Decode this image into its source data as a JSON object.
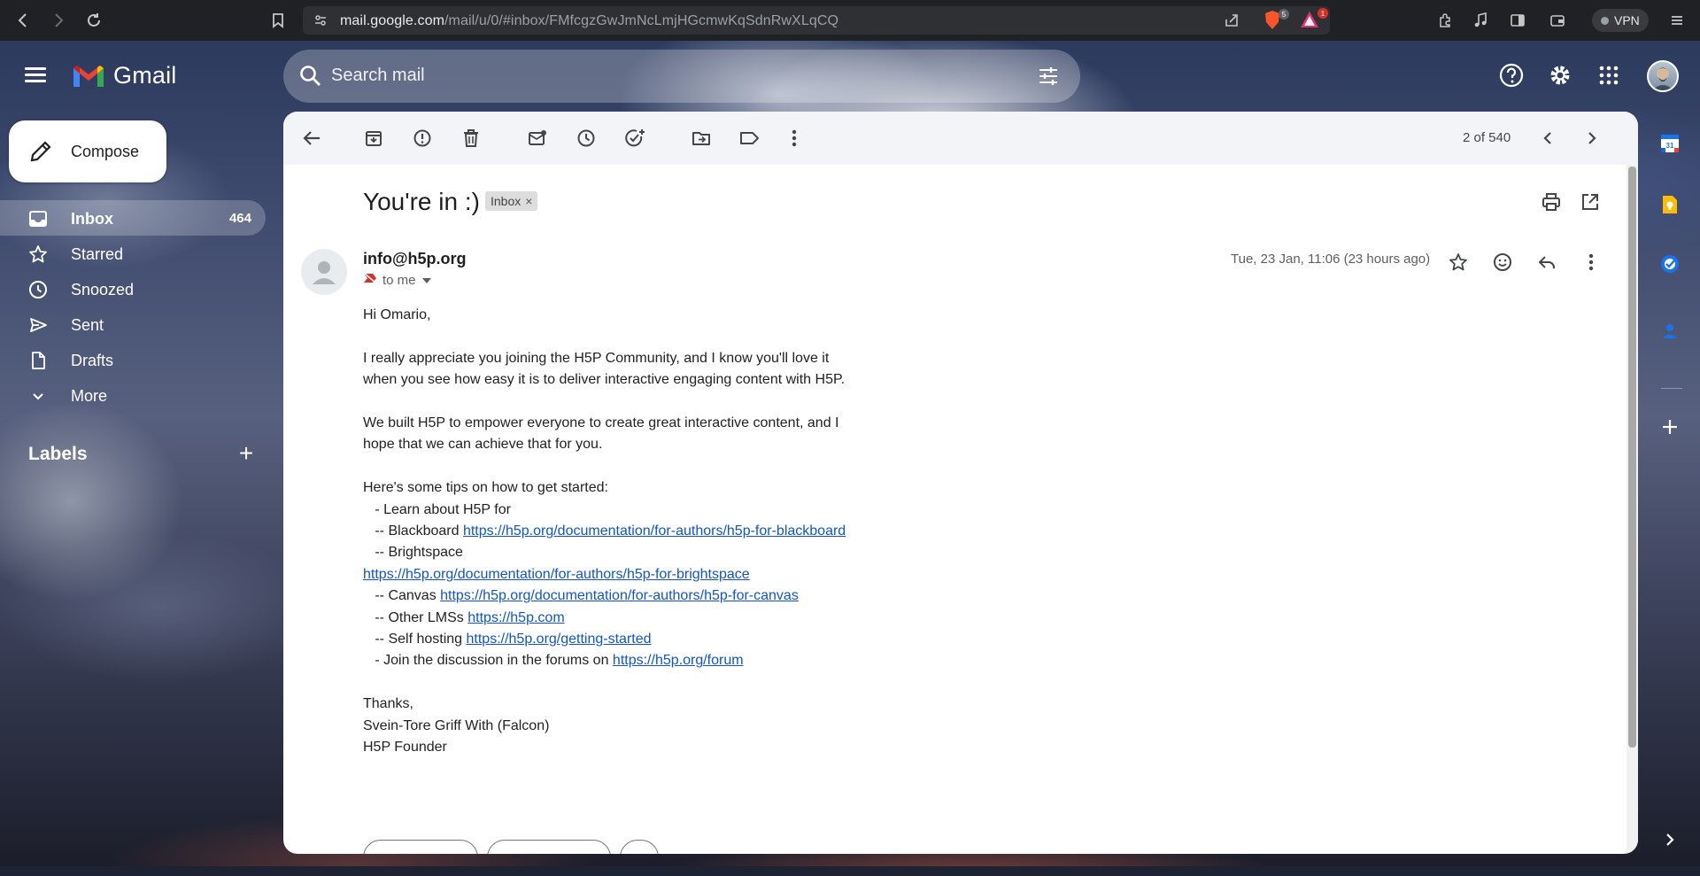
{
  "browser": {
    "url_host": "mail.google.com",
    "url_path": "/mail/u/0/#inbox/FMfcgzGwJmNcLmjHGcmwKqSdnRwXLqCQ",
    "brave_badge": "5",
    "rewards_badge": "1",
    "vpn_label": "VPN"
  },
  "header": {
    "app_name": "Gmail",
    "search_placeholder": "Search mail"
  },
  "sidebar": {
    "compose_label": "Compose",
    "items": [
      {
        "label": "Inbox",
        "count": "464",
        "icon": "inbox-icon"
      },
      {
        "label": "Starred",
        "count": "",
        "icon": "star-icon"
      },
      {
        "label": "Snoozed",
        "count": "",
        "icon": "clock-icon"
      },
      {
        "label": "Sent",
        "count": "",
        "icon": "send-icon"
      },
      {
        "label": "Drafts",
        "count": "",
        "icon": "draft-icon"
      },
      {
        "label": "More",
        "count": "",
        "icon": "chevron-down-icon"
      }
    ],
    "labels_heading": "Labels"
  },
  "toolbar": {
    "pager": "2 of 540"
  },
  "message": {
    "subject": "You're in :)",
    "tag": "Inbox",
    "sender": "info@h5p.org",
    "recipient": "to me",
    "date": "Tue, 23 Jan, 11:06 (23 hours ago)",
    "body": {
      "greeting": "Hi Omario,",
      "p1_l1": "I really appreciate you joining the H5P Community, and I know you'll love it",
      "p1_l2": "when you see how easy it is to deliver interactive engaging content with H5P.",
      "p2_l1": "We built H5P to empower everyone to create great interactive content, and I",
      "p2_l2": "hope that we can achieve that for you.",
      "tips_intro": "Here's some tips on how to get started:",
      "tip_learn": "   - Learn about H5P for",
      "tip_blackboard": "   -- Blackboard ",
      "link_blackboard": "https://h5p.org/documentation/for-authors/h5p-for-blackboard",
      "tip_brightspace": "   -- Brightspace",
      "link_brightspace": "https://h5p.org/documentation/for-authors/h5p-for-brightspace",
      "tip_canvas": "   -- Canvas ",
      "link_canvas": "https://h5p.org/documentation/for-authors/h5p-for-canvas",
      "tip_other": "   -- Other LMSs ",
      "link_other": "https://h5p.com",
      "tip_self": "   -- Self hosting ",
      "link_self": "https://h5p.org/getting-started",
      "tip_forum": "   - Join the discussion in the forums on ",
      "link_forum": "https://h5p.org/forum",
      "thanks": "Thanks,",
      "signature_name": "Svein-Tore Griff With (Falcon)",
      "signature_title": "H5P Founder"
    }
  },
  "colors": {
    "accent_blue": "#1a73e8",
    "link": "#1155cc",
    "gmail_red": "#ea4335"
  }
}
